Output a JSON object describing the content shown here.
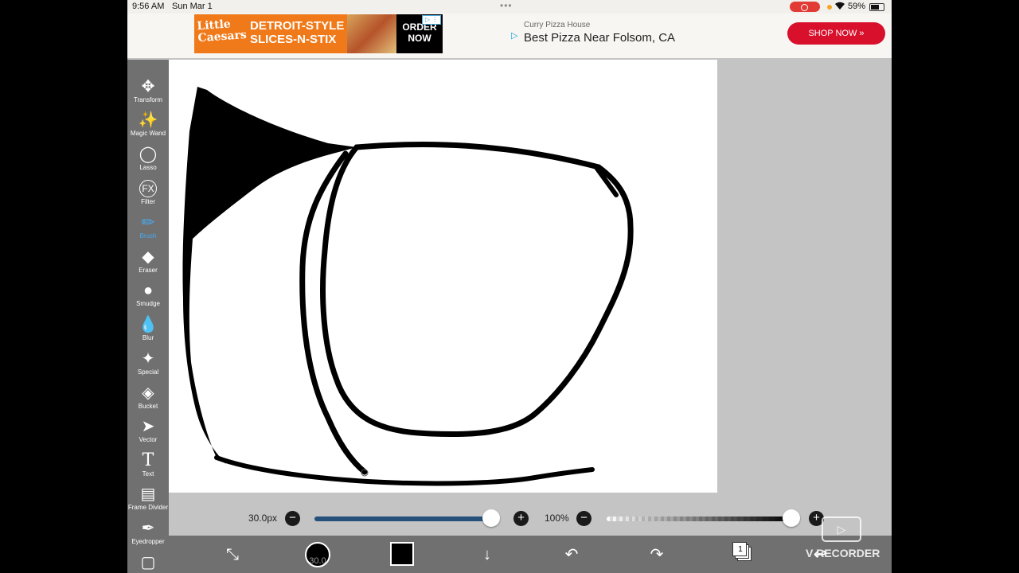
{
  "status_bar": {
    "time": "9:56 AM",
    "date": "Sun Mar 1",
    "battery": "59%"
  },
  "ads": {
    "left": {
      "brand": "Little Caesars",
      "headline": "DETROIT-STYLE SLICES-N-STIX",
      "cta": "ORDER NOW"
    },
    "right": {
      "advertiser": "Curry Pizza House",
      "tagline": "Best Pizza Near Folsom, CA",
      "cta": "SHOP NOW »"
    }
  },
  "toolbar": {
    "active_tool": "Brush",
    "tools": [
      {
        "label": "Transform",
        "icon": "move-arrows-icon"
      },
      {
        "label": "Magic Wand",
        "icon": "magic-wand-icon"
      },
      {
        "label": "Lasso",
        "icon": "lasso-icon"
      },
      {
        "label": "Filter",
        "icon": "fx-icon"
      },
      {
        "label": "Brush",
        "icon": "brush-icon"
      },
      {
        "label": "Eraser",
        "icon": "eraser-icon"
      },
      {
        "label": "Smudge",
        "icon": "smudge-icon"
      },
      {
        "label": "Blur",
        "icon": "drop-icon"
      },
      {
        "label": "Special",
        "icon": "sparkle-icon"
      },
      {
        "label": "Bucket",
        "icon": "bucket-icon"
      },
      {
        "label": "Vector",
        "icon": "cursor-arrow-icon"
      },
      {
        "label": "Text",
        "icon": "text-t-icon"
      },
      {
        "label": "Frame Divider",
        "icon": "frame-divider-icon"
      },
      {
        "label": "Eyedropper",
        "icon": "eyedropper-icon"
      }
    ]
  },
  "brush_settings": {
    "size_label": "30.0px",
    "size_fraction": 0.98,
    "opacity_label": "100%",
    "opacity_fraction": 1.0
  },
  "bottom_bar": {
    "brush_size_badge": "30.0",
    "current_color": "#000000",
    "layer_count": "1"
  },
  "watermark": "V RECORDER"
}
